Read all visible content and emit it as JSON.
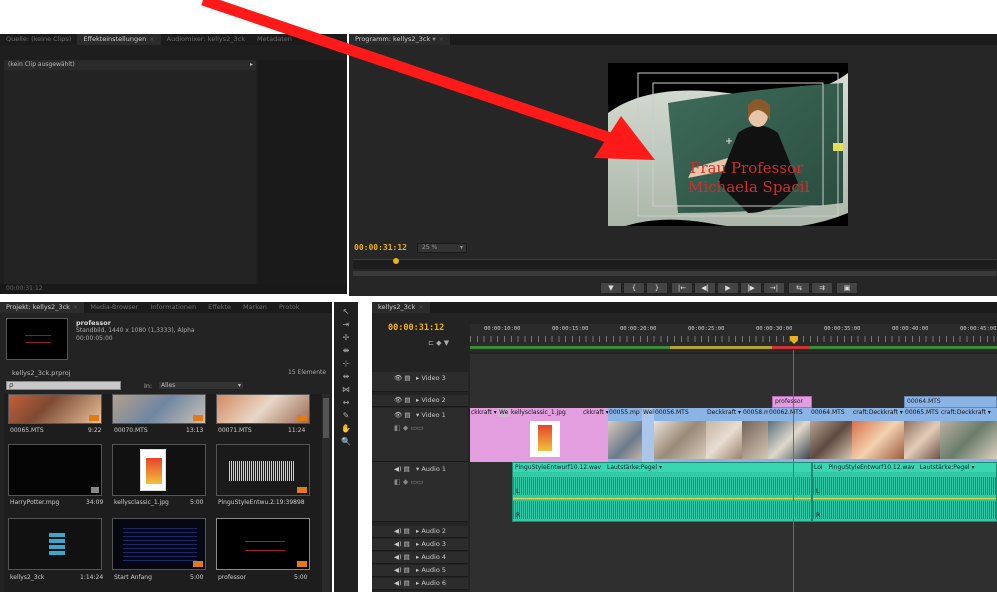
{
  "source_panel": {
    "tabs": [
      "Quelle: (keine Clips)",
      "Effekteinstellungen",
      "Audiomixer: kellys2_3ck",
      "Metadaten"
    ],
    "close_glyph": "×",
    "no_clip": "(kein Clip ausgewählt)",
    "footer_time": "00:00:31:12"
  },
  "program_monitor": {
    "tab": "Programm: kellys2_3ck",
    "timecode": "00:00:31:12",
    "zoom": "25 %",
    "overlay_line1": "Frau Professor",
    "overlay_line2": "Michaela Spacil",
    "transport_buttons": [
      "▼",
      "{",
      "}",
      "|←",
      "◀|",
      "▶",
      "|▶",
      "→|",
      "⇆",
      "⇉",
      "▣"
    ]
  },
  "project_panel": {
    "tabs": [
      "Projekt: kellys2_3ck",
      "Media-Browser",
      "Informationen",
      "Effekte",
      "Marken",
      "Protok"
    ],
    "preview_name": "professor",
    "preview_info1": "Standbild, 1440 x 1080 (1,3333), Alpha",
    "preview_info2": "00:00:05:00",
    "project_file": "kellys2_3ck.prproj",
    "element_count": "15 Elemente",
    "search_placeholder": "ρ",
    "in_label": "In:",
    "in_value": "Alles",
    "items": [
      {
        "name": "00065.MTS",
        "duration": "9:22"
      },
      {
        "name": "00070.MTS",
        "duration": "13:13"
      },
      {
        "name": "00071.MTS",
        "duration": "11:24"
      },
      {
        "name": "HarryPotter.mpg",
        "duration": "34:09"
      },
      {
        "name": "kellysclassic_1.jpg",
        "duration": "5:00"
      },
      {
        "name": "PinguStyleEntwu...",
        "duration": "2:19:39898"
      },
      {
        "name": "kellys2_3ck",
        "duration": "1:14:24"
      },
      {
        "name": "Start Anfang",
        "duration": "5:00"
      },
      {
        "name": "professor",
        "duration": "5:00"
      }
    ]
  },
  "timeline": {
    "tab": "kellys2_3ck",
    "timecode": "00:00:31:12",
    "ruler": [
      "00:00:10:00",
      "00:00:15:00",
      "00:00:20:00",
      "00:00:25:00",
      "00:00:30:00",
      "00:00:35:00",
      "00:00:40:00",
      "00:00:45:00"
    ],
    "tracks": {
      "video3": "Video 3",
      "video2": "Video 2",
      "video1": "Video 1",
      "audio1": "Audio 1",
      "audio2": "Audio 2",
      "audio3": "Audio 3",
      "audio4": "Audio 4",
      "audio5": "Audio 5",
      "audio6": "Audio 6"
    },
    "clip_professor": "professor",
    "clip_00064_v2": "00064.MTS",
    "v1_clips": [
      "ckkraft ▾",
      "We",
      "kellysclassic_1.jpg",
      "ckkraft ▾",
      "00055.mp",
      "Wel",
      "00056.MTS",
      "Deckkraft ▾",
      "00058.mp",
      "00062.MTS",
      "00064.MTS",
      "craft:Deckkraft ▾",
      "00065.MTS",
      "craft:Deckkraft ▾"
    ],
    "audio_clip1": "PinguStyleEntwurf10.12.wav",
    "audio_clip1_fx": "Lautstärke:Pegel ▾",
    "audio_clip2_short": "Loi",
    "audio_clip2": "PinguStyleEntwurf10.12.wav",
    "audio_clip2_fx": "Lautstärke:Pegel ▾",
    "channel_l": "L",
    "channel_r": "R"
  },
  "tools": [
    "↖",
    "⇥",
    "✢",
    "⇼",
    "⊹",
    "⇹",
    "⋈",
    "↔",
    "✎",
    "✋",
    "🔍"
  ],
  "colors": {
    "accent_timecode": "#e9b21d",
    "arrow": "#ff1a1a",
    "clip_video": "#8ab4e6",
    "clip_still": "#e39ee0",
    "clip_audio": "#33c9a5",
    "playhead": "#d24040"
  }
}
